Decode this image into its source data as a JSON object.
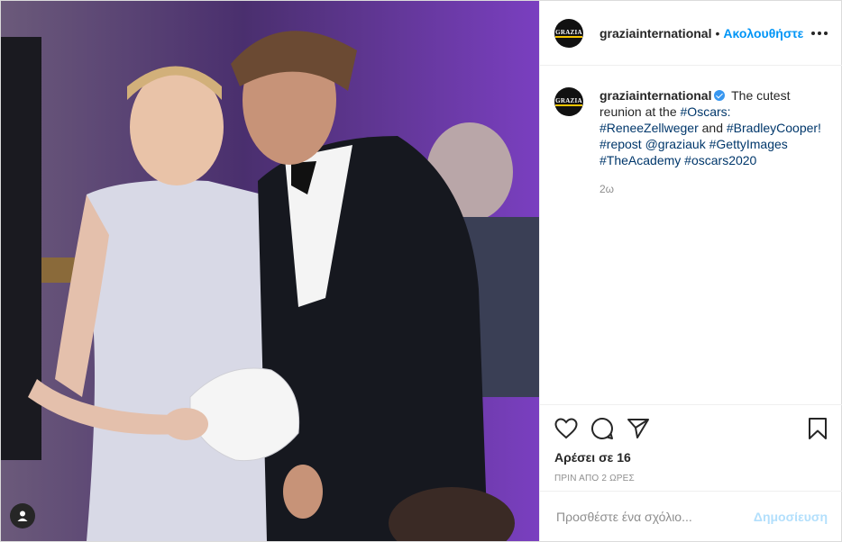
{
  "header": {
    "avatar_text": "GRAZIA",
    "username": "graziainternational",
    "separator": "•",
    "follow_label": "Ακολουθήστε"
  },
  "caption": {
    "username": "graziainternational",
    "text_intro": "The cutest reunion at the",
    "hashtag_oscars": "#Oscars:",
    "hashtag_renee": "#ReneeZellweger",
    "and_word": "and",
    "hashtag_bradley": "#BradleyCooper!",
    "hashtag_repost": "#repost",
    "mention": "@graziauk",
    "hashtag_getty": "#GettyImages",
    "hashtag_academy": "#TheAcademy",
    "hashtag_oscars2020": "#oscars2020",
    "time_ago": "2ω"
  },
  "actions": {
    "like_icon": "heart-icon",
    "comment_icon": "comment-icon",
    "share_icon": "paper-plane-icon",
    "save_icon": "bookmark-icon",
    "likes_text": "Αρέσει σε 16",
    "posted_text": "ΠΡΙΝ ΑΠΟ 2 ΩΡΕΣ"
  },
  "comment": {
    "placeholder": "Προσθέστε ένα σχόλιο...",
    "post_label": "Δημοσίευση"
  },
  "colors": {
    "link_blue": "#0095f6",
    "hashtag_blue": "#00376b",
    "post_disabled": "#b2dffc",
    "muted": "#8e8e8e"
  }
}
